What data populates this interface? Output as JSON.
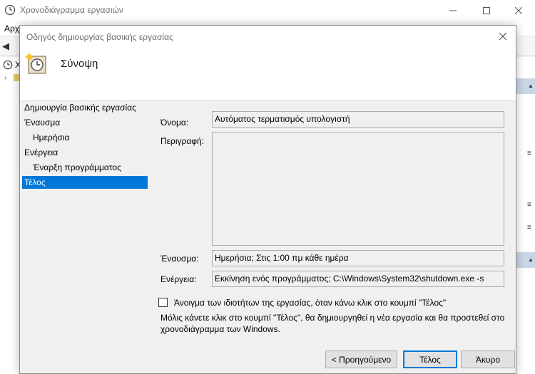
{
  "background_window": {
    "title": "Χρονοδιάγραμμα εργασιών",
    "menu_first": "Αρχ",
    "tree_item": "Χ"
  },
  "dialog": {
    "title": "Οδηγός δημιουργίας βασικής εργασίας",
    "header": "Σύνοψη",
    "nav": [
      "Δημιουργία βασικής εργασίας",
      "Έναυσμα",
      "Ημερήσια",
      "Ενέργεια",
      "Έναρξη προγράμματος",
      "Τέλος"
    ],
    "form": {
      "name_label": "Όνομα:",
      "name_value": "Αυτόματος τερματισμός υπολογιστή",
      "description_label": "Περιγραφή:",
      "description_value": "",
      "trigger_label": "Έναυσμα:",
      "trigger_value": "Ημερήσια; Στις 1:00 πμ κάθε ημέρα",
      "action_label": "Ενέργεια:",
      "action_value": "Εκκίνηση ενός προγράμματος; C:\\Windows\\System32\\shutdown.exe -s"
    },
    "checkbox_label": "Άνοιγμα των ιδιοτήτων της εργασίας, όταν κάνω κλικ στο κουμπί \"Τέλος\"",
    "checkbox_checked": false,
    "info_text": "Μόλις κάνετε κλικ στο κουμπί \"Τέλος\", θα δημιουργηθεί η νέα εργασία και θα προστεθεί στο χρονοδιάγραμμα των Windows.",
    "buttons": {
      "back": "< Προηγούμενο",
      "finish": "Τέλος",
      "cancel": "Άκυρο"
    }
  },
  "colors": {
    "selection": "#0078d7",
    "dialog_bg": "#f0f0f0",
    "header_bg": "#ffffff"
  }
}
